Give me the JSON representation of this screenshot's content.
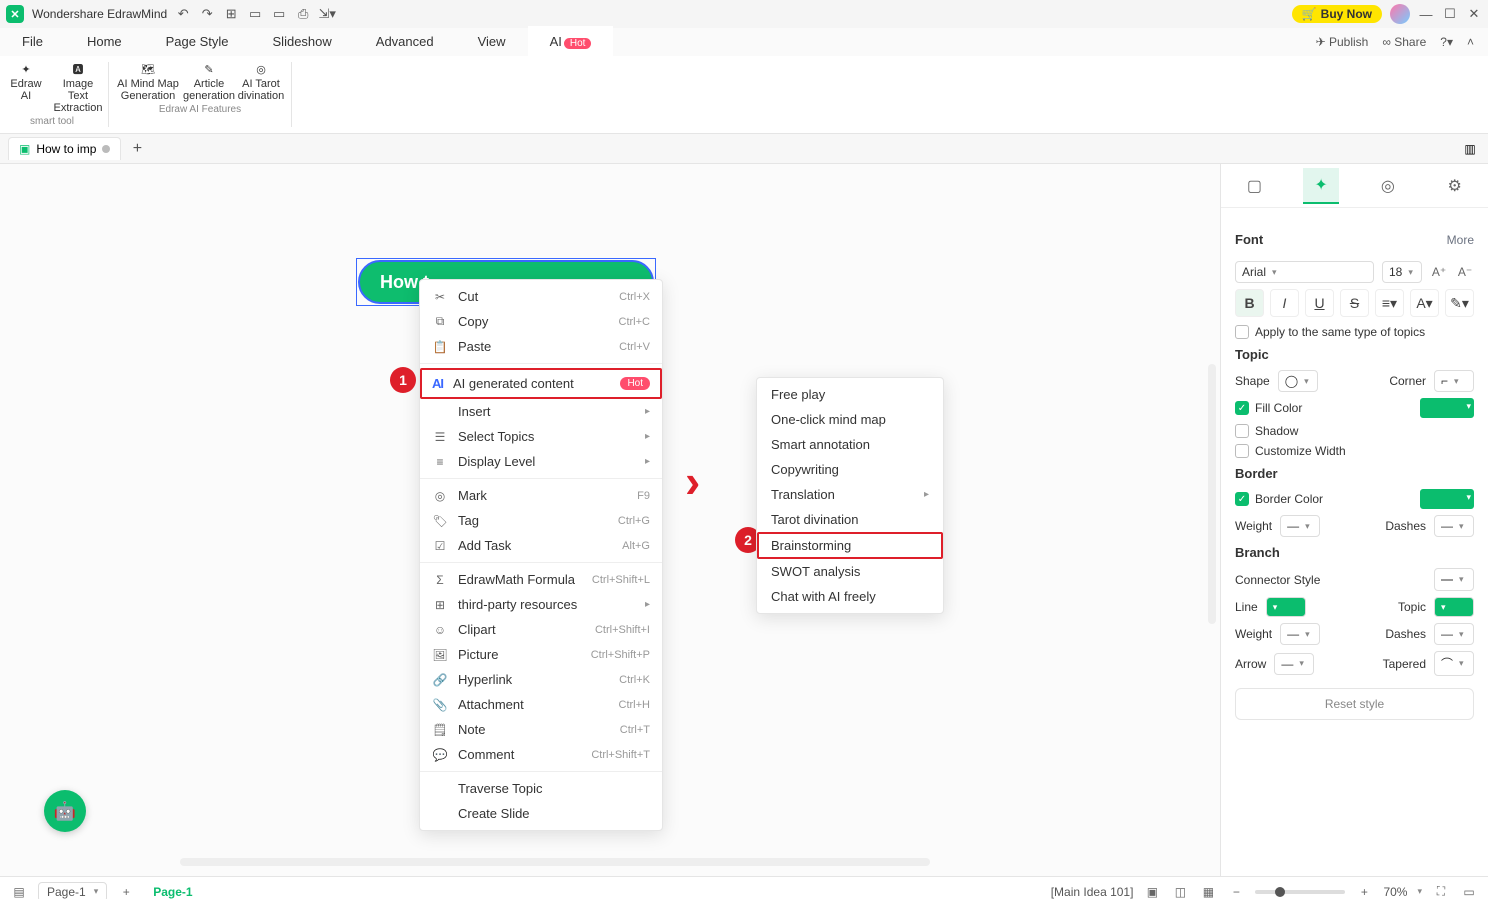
{
  "titlebar": {
    "app_name": "Wondershare EdrawMind",
    "buy_now": "Buy Now"
  },
  "menubar": {
    "tabs": [
      "File",
      "Home",
      "Page Style",
      "Slideshow",
      "Advanced",
      "View",
      "AI"
    ],
    "ai_badge": "Hot",
    "publish": "Publish",
    "share": "Share"
  },
  "ribbon": {
    "smart_tool_label": "smart tool",
    "features_label": "Edraw AI Features",
    "tools": {
      "edraw_ai": "Edraw\nAI",
      "image_text": "Image Text\nExtraction",
      "mindmap": "AI Mind Map\nGeneration",
      "article": "Article\ngeneration",
      "tarot": "AI Tarot\ndivination"
    }
  },
  "doctabs": {
    "tab1": "How to imp"
  },
  "node_text": "How t",
  "context_menu": {
    "cut": "Cut",
    "cut_sc": "Ctrl+X",
    "copy": "Copy",
    "copy_sc": "Ctrl+C",
    "paste": "Paste",
    "paste_sc": "Ctrl+V",
    "ai_gen": "AI generated content",
    "ai_hot": "Hot",
    "insert": "Insert",
    "select_topics": "Select Topics",
    "display_level": "Display Level",
    "mark": "Mark",
    "mark_sc": "F9",
    "tag": "Tag",
    "tag_sc": "Ctrl+G",
    "add_task": "Add Task",
    "add_task_sc": "Alt+G",
    "formula": "EdrawMath Formula",
    "formula_sc": "Ctrl+Shift+L",
    "third_party": "third-party resources",
    "clipart": "Clipart",
    "clipart_sc": "Ctrl+Shift+I",
    "picture": "Picture",
    "picture_sc": "Ctrl+Shift+P",
    "hyperlink": "Hyperlink",
    "hyperlink_sc": "Ctrl+K",
    "attachment": "Attachment",
    "attachment_sc": "Ctrl+H",
    "note": "Note",
    "note_sc": "Ctrl+T",
    "comment": "Comment",
    "comment_sc": "Ctrl+Shift+T",
    "traverse": "Traverse Topic",
    "create_slide": "Create Slide"
  },
  "submenu": {
    "free_play": "Free play",
    "one_click": "One-click mind map",
    "smart_annotation": "Smart annotation",
    "copywriting": "Copywriting",
    "translation": "Translation",
    "tarot": "Tarot divination",
    "brainstorming": "Brainstorming",
    "swot": "SWOT analysis",
    "chat": "Chat with AI freely"
  },
  "badges": {
    "one": "1",
    "two": "2"
  },
  "panel": {
    "font_h": "Font",
    "more": "More",
    "font_family": "Arial",
    "font_size": "18",
    "apply_same": "Apply to the same type of topics",
    "topic_h": "Topic",
    "shape": "Shape",
    "corner": "Corner",
    "fill_color": "Fill Color",
    "shadow": "Shadow",
    "custom_width": "Customize Width",
    "border_h": "Border",
    "border_color": "Border Color",
    "weight": "Weight",
    "dashes": "Dashes",
    "branch_h": "Branch",
    "connector": "Connector Style",
    "line": "Line",
    "topic_color": "Topic",
    "arrow": "Arrow",
    "tapered": "Tapered",
    "reset": "Reset style"
  },
  "statusbar": {
    "page_select": "Page-1",
    "page_tab": "Page-1",
    "main_idea": "[Main Idea 101]",
    "zoom": "70%"
  }
}
